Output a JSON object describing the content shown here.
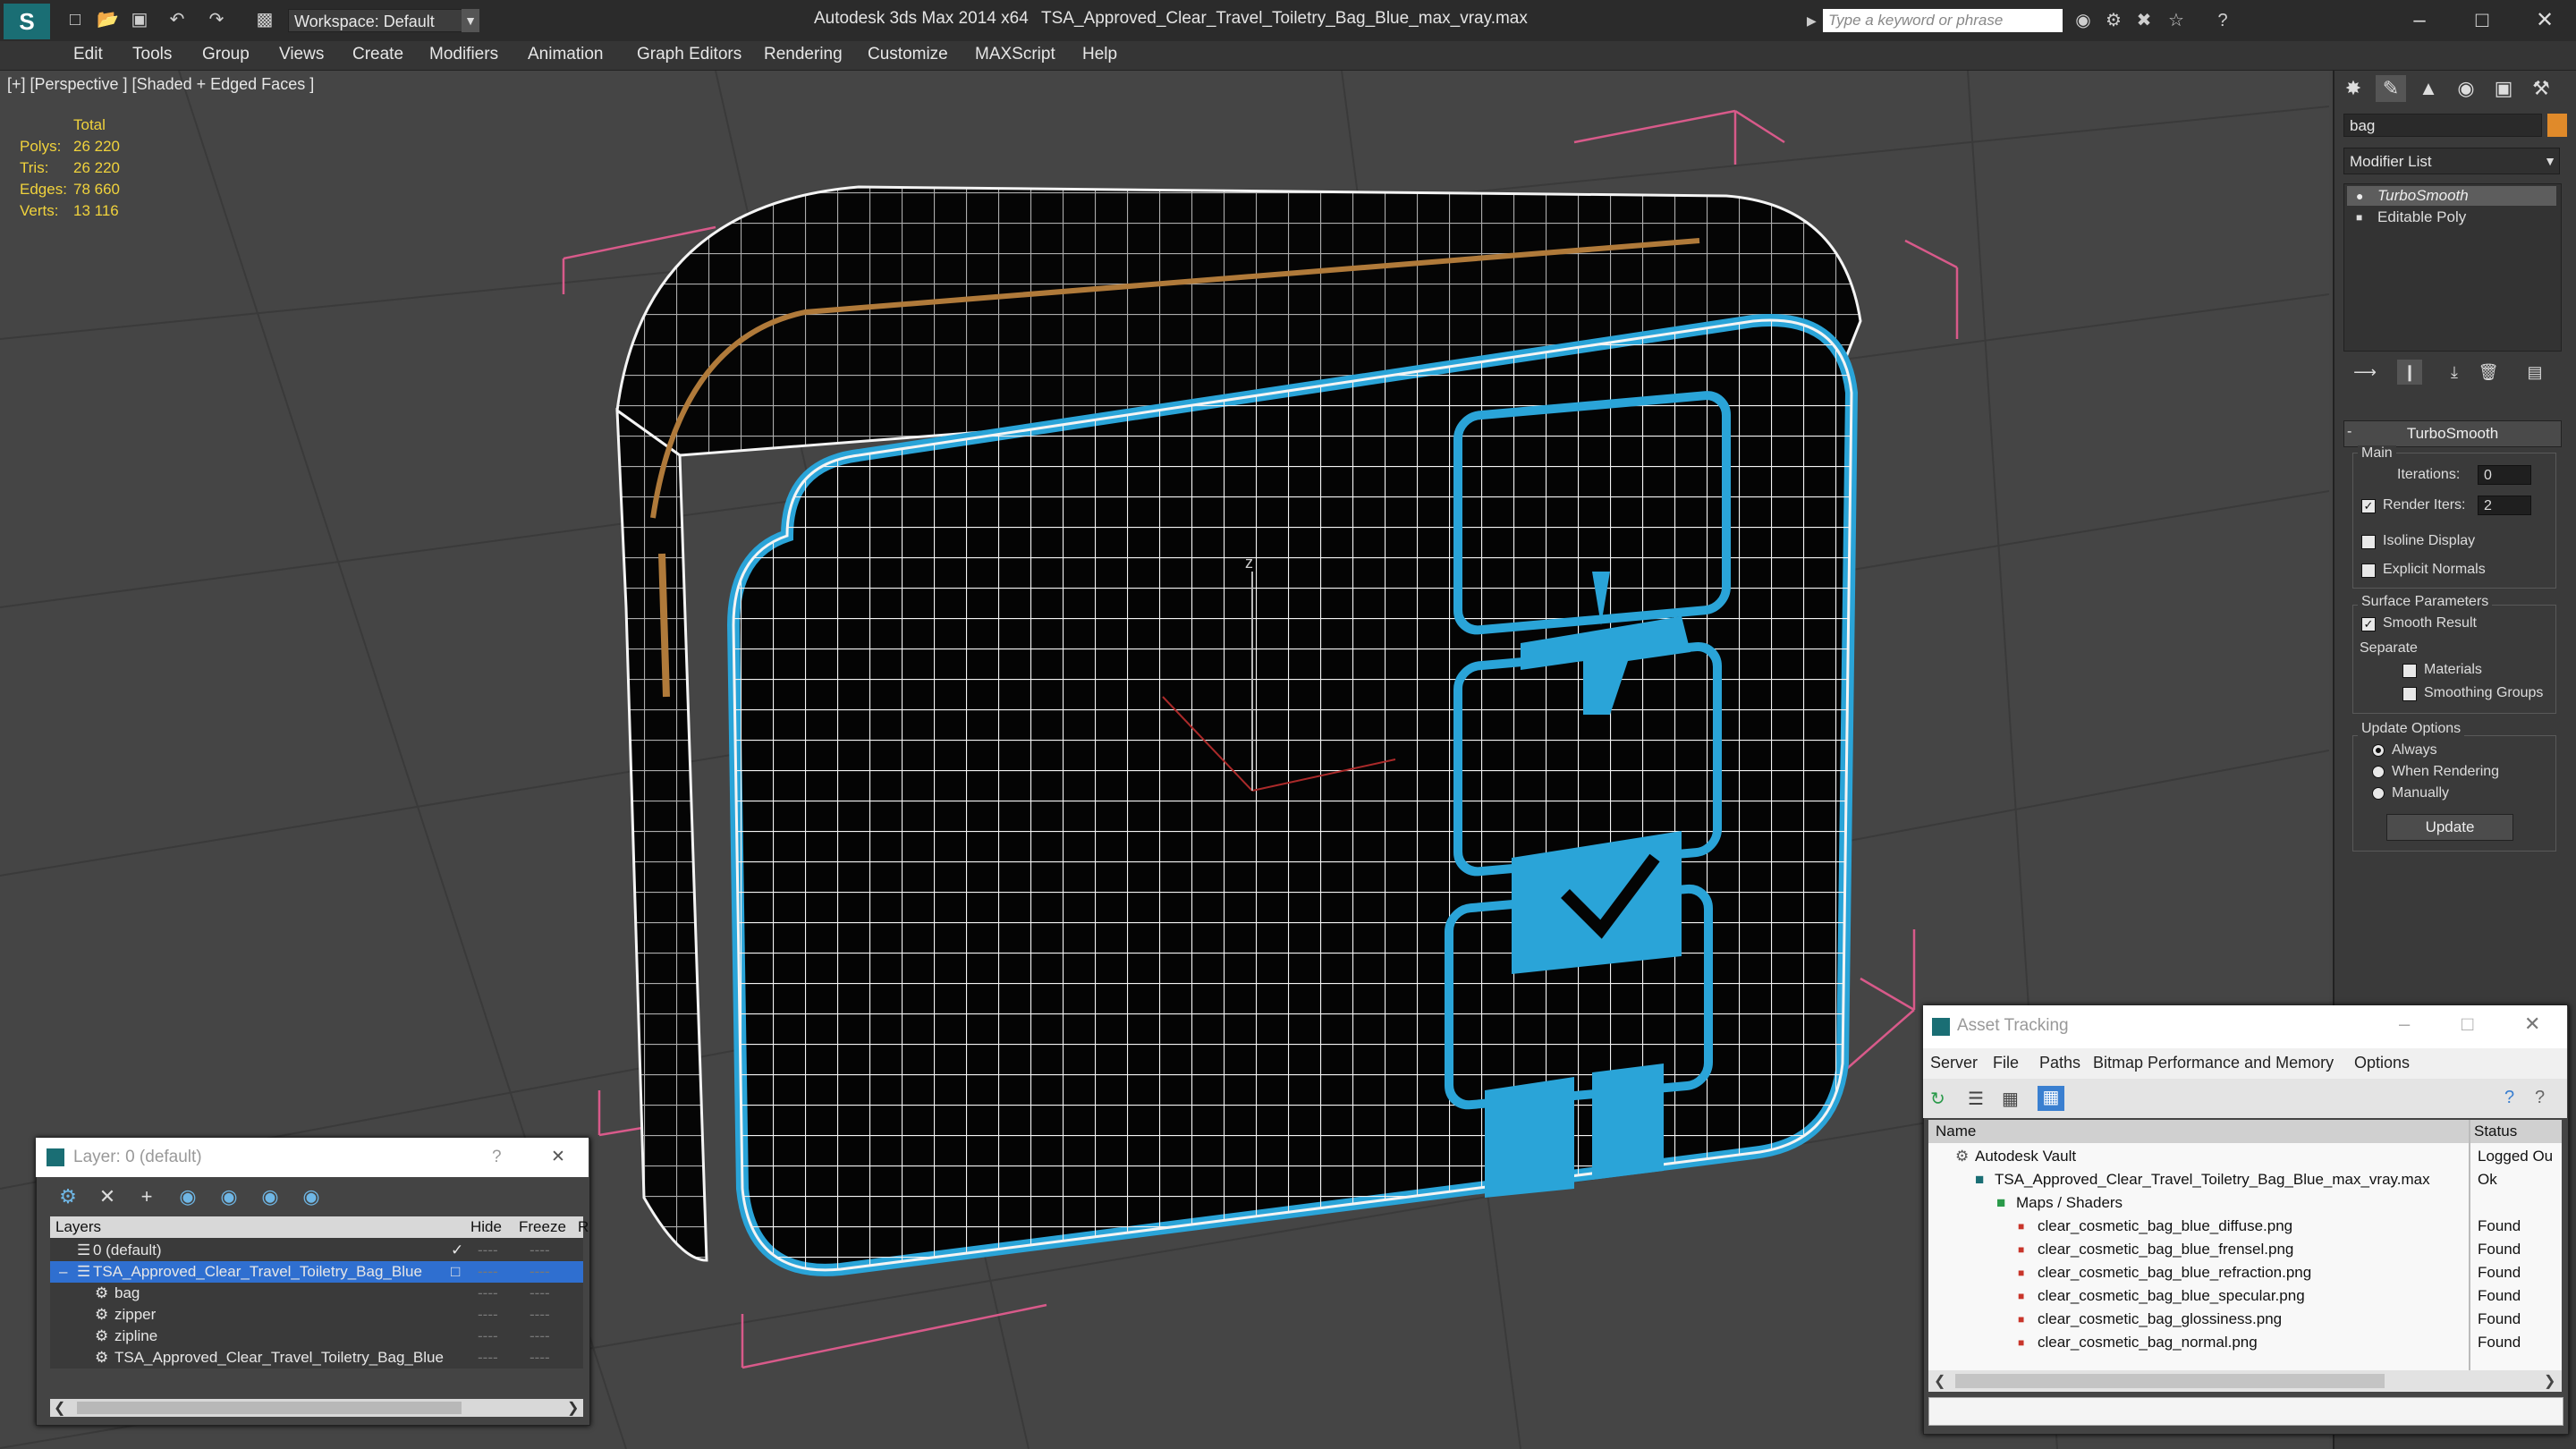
{
  "titlebar": {
    "app_title": "Autodesk 3ds Max  2014 x64",
    "file_title": "TSA_Approved_Clear_Travel_Toiletry_Bag_Blue_max_vray.max",
    "workspace": "Workspace: Default",
    "search_placeholder": "Type a keyword or phrase"
  },
  "menu": [
    "Edit",
    "Tools",
    "Group",
    "Views",
    "Create",
    "Modifiers",
    "Animation",
    "Graph Editors",
    "Rendering",
    "Customize",
    "MAXScript",
    "Help"
  ],
  "viewport": {
    "label": "[+] [Perspective ] [Shaded + Edged Faces ]",
    "stats_header": "Total",
    "stats": [
      {
        "label": "Polys:",
        "value": "26 220"
      },
      {
        "label": "Tris:",
        "value": "26 220"
      },
      {
        "label": "Edges:",
        "value": "78 660"
      },
      {
        "label": "Verts:",
        "value": "13 116"
      }
    ],
    "axis_label": "z"
  },
  "command_panel": {
    "object_name": "bag",
    "object_color": "#e08a2a",
    "modifier_list": "Modifier List",
    "stack": [
      "TurboSmooth",
      "Editable Poly"
    ],
    "rollout_title": "TurboSmooth",
    "main_group": "Main",
    "iterations_label": "Iterations:",
    "iterations_value": "0",
    "render_iters_label": "Render Iters:",
    "render_iters_value": "2",
    "isoline_label": "Isoline Display",
    "explicit_label": "Explicit Normals",
    "surface_group": "Surface Parameters",
    "smooth_result_label": "Smooth Result",
    "separate_label": "Separate",
    "materials_label": "Materials",
    "smoothing_groups_label": "Smoothing Groups",
    "update_group": "Update Options",
    "always_label": "Always",
    "when_rendering_label": "When Rendering",
    "manually_label": "Manually",
    "update_button": "Update"
  },
  "layer_window": {
    "title": "Layer: 0 (default)",
    "help_glyph": "?",
    "columns": [
      "Layers",
      "Hide",
      "Freeze",
      "R"
    ],
    "rows": [
      {
        "name": "0 (default)",
        "checked": true
      },
      {
        "name": "TSA_Approved_Clear_Travel_Toiletry_Bag_Blue",
        "selected": true
      },
      {
        "name": "bag"
      },
      {
        "name": "zipper"
      },
      {
        "name": "zipline"
      },
      {
        "name": "TSA_Approved_Clear_Travel_Toiletry_Bag_Blue"
      }
    ],
    "dash": "----"
  },
  "asset_window": {
    "title": "Asset Tracking",
    "menu": [
      "Server",
      "File",
      "Paths",
      "Bitmap Performance and Memory",
      "Options"
    ],
    "columns": [
      "Name",
      "Status"
    ],
    "rows": [
      {
        "name": "Autodesk Vault",
        "status": "Logged Ou"
      },
      {
        "name": "TSA_Approved_Clear_Travel_Toiletry_Bag_Blue_max_vray.max",
        "status": "Ok"
      },
      {
        "name": "Maps / Shaders",
        "status": ""
      },
      {
        "name": "clear_cosmetic_bag_blue_diffuse.png",
        "status": "Found"
      },
      {
        "name": "clear_cosmetic_bag_blue_frensel.png",
        "status": "Found"
      },
      {
        "name": "clear_cosmetic_bag_blue_refraction.png",
        "status": "Found"
      },
      {
        "name": "clear_cosmetic_bag_blue_specular.png",
        "status": "Found"
      },
      {
        "name": "clear_cosmetic_bag_glossiness.png",
        "status": "Found"
      },
      {
        "name": "clear_cosmetic_bag_normal.png",
        "status": "Found"
      }
    ]
  },
  "colors": {
    "accent_blue": "#2aa4d8",
    "stats_yellow": "#f0d23c",
    "bbox_pink": "#d85a8a",
    "selection_blue": "#2f6fd0"
  }
}
